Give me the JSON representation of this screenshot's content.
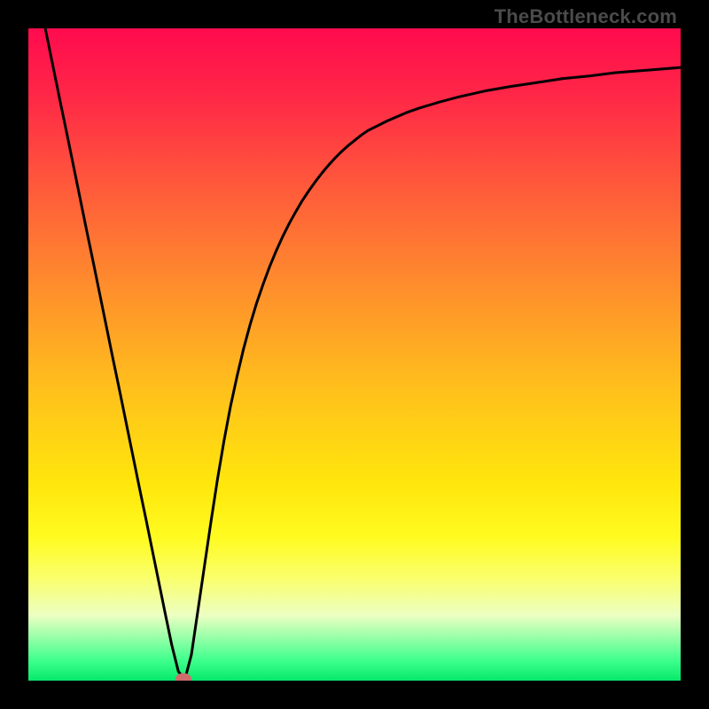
{
  "watermark": "TheBottleneck.com",
  "colors": {
    "border": "#000000",
    "gradient_stops": [
      {
        "offset": 0.0,
        "color": "#ff0b4e"
      },
      {
        "offset": 0.1,
        "color": "#ff2647"
      },
      {
        "offset": 0.25,
        "color": "#ff5c3a"
      },
      {
        "offset": 0.4,
        "color": "#ff8f2c"
      },
      {
        "offset": 0.55,
        "color": "#ffbf1c"
      },
      {
        "offset": 0.7,
        "color": "#ffe70c"
      },
      {
        "offset": 0.78,
        "color": "#fffb20"
      },
      {
        "offset": 0.84,
        "color": "#faff68"
      },
      {
        "offset": 0.9,
        "color": "#ecffc2"
      },
      {
        "offset": 0.97,
        "color": "#3cff8c"
      },
      {
        "offset": 1.0,
        "color": "#06e96a"
      }
    ],
    "curve": "#000000",
    "marker": "#cf6d6d"
  },
  "chart_data": {
    "type": "line",
    "title": "",
    "xlabel": "",
    "ylabel": "",
    "x": [
      0.0,
      0.01,
      0.02,
      0.03,
      0.04,
      0.05,
      0.06,
      0.07,
      0.08,
      0.09,
      0.1,
      0.11,
      0.12,
      0.13,
      0.14,
      0.15,
      0.16,
      0.17,
      0.18,
      0.19,
      0.2,
      0.21,
      0.22,
      0.23,
      0.24,
      0.25,
      0.26,
      0.27,
      0.28,
      0.29,
      0.3,
      0.31,
      0.32,
      0.33,
      0.34,
      0.35,
      0.36,
      0.37,
      0.38,
      0.39,
      0.4,
      0.41,
      0.42,
      0.43,
      0.44,
      0.45,
      0.46,
      0.47,
      0.48,
      0.49,
      0.5,
      0.51,
      0.52,
      0.55,
      0.58,
      0.6,
      0.63,
      0.66,
      0.7,
      0.74,
      0.78,
      0.82,
      0.86,
      0.9,
      0.95,
      1.0
    ],
    "y": [
      1.126,
      1.077,
      1.029,
      0.98,
      0.931,
      0.882,
      0.834,
      0.785,
      0.736,
      0.687,
      0.639,
      0.59,
      0.541,
      0.492,
      0.444,
      0.395,
      0.346,
      0.297,
      0.249,
      0.2,
      0.151,
      0.102,
      0.054,
      0.014,
      0.002,
      0.04,
      0.108,
      0.176,
      0.244,
      0.309,
      0.368,
      0.421,
      0.467,
      0.509,
      0.546,
      0.579,
      0.608,
      0.635,
      0.659,
      0.681,
      0.701,
      0.719,
      0.736,
      0.751,
      0.765,
      0.778,
      0.79,
      0.801,
      0.811,
      0.82,
      0.828,
      0.836,
      0.843,
      0.858,
      0.871,
      0.878,
      0.887,
      0.895,
      0.904,
      0.911,
      0.917,
      0.923,
      0.927,
      0.932,
      0.936,
      0.94
    ],
    "xlim": [
      0,
      1
    ],
    "ylim": [
      0,
      1
    ],
    "marker": {
      "x": 0.238,
      "y": 0.003
    },
    "notes": "x and y are normalized to the plotting rectangle; curve is a V-shaped bottleneck profile with minimum near x≈0.24."
  }
}
